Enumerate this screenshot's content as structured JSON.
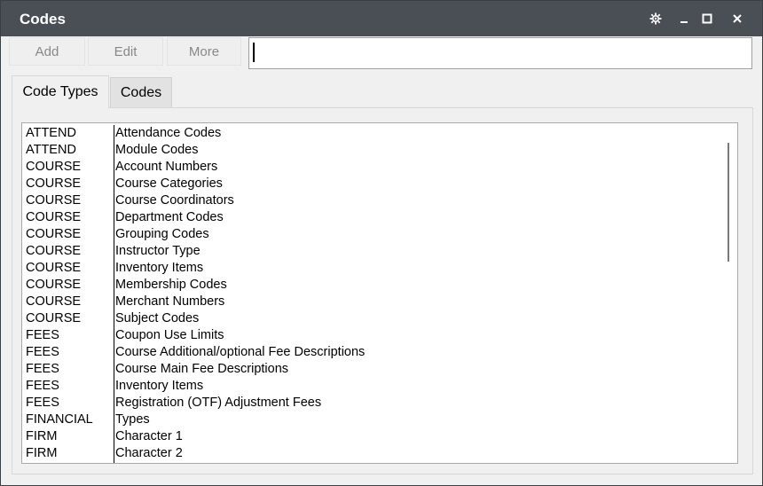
{
  "window": {
    "title": "Codes"
  },
  "titlebar": {
    "settings_icon": "gear-icon",
    "minimize_icon": "minimize-icon",
    "maximize_icon": "maximize-icon",
    "close_icon": "close-icon"
  },
  "toolbar": {
    "add_label": "Add",
    "edit_label": "Edit",
    "more_label": "More",
    "search_value": ""
  },
  "tabs": [
    {
      "label": "Code Types"
    },
    {
      "label": "Codes"
    }
  ],
  "list": {
    "rows": [
      {
        "type": "ATTEND",
        "description": "Attendance Codes"
      },
      {
        "type": "ATTEND",
        "description": "Module Codes"
      },
      {
        "type": "COURSE",
        "description": "Account Numbers"
      },
      {
        "type": "COURSE",
        "description": "Course Categories"
      },
      {
        "type": "COURSE",
        "description": "Course Coordinators"
      },
      {
        "type": "COURSE",
        "description": "Department Codes"
      },
      {
        "type": "COURSE",
        "description": "Grouping Codes"
      },
      {
        "type": "COURSE",
        "description": "Instructor Type"
      },
      {
        "type": "COURSE",
        "description": "Inventory Items"
      },
      {
        "type": "COURSE",
        "description": "Membership Codes"
      },
      {
        "type": "COURSE",
        "description": "Merchant Numbers"
      },
      {
        "type": "COURSE",
        "description": "Subject Codes"
      },
      {
        "type": "FEES",
        "description": "Coupon Use Limits"
      },
      {
        "type": "FEES",
        "description": "Course Additional/optional Fee Descriptions"
      },
      {
        "type": "FEES",
        "description": "Course Main Fee Descriptions"
      },
      {
        "type": "FEES",
        "description": "Inventory Items"
      },
      {
        "type": "FEES",
        "description": "Registration (OTF) Adjustment Fees"
      },
      {
        "type": "FINANCIAL",
        "description": "Types"
      },
      {
        "type": "FIRM",
        "description": "Character 1"
      },
      {
        "type": "FIRM",
        "description": "Character 2"
      }
    ]
  }
}
